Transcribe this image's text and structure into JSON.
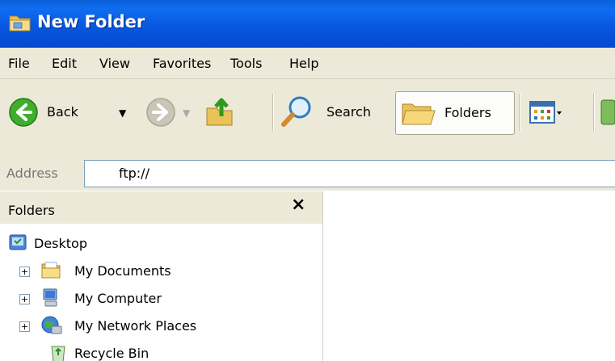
{
  "window": {
    "title": "New Folder"
  },
  "menu": [
    "File",
    "Edit",
    "View",
    "Favorites",
    "Tools",
    "Help"
  ],
  "toolbar": {
    "back_label": "Back",
    "search_label": "Search",
    "folders_label": "Folders"
  },
  "address": {
    "label": "Address",
    "value": "ftp://"
  },
  "folders_pane": {
    "title": "Folders",
    "close_glyph": "×",
    "items": [
      {
        "label": "Desktop",
        "icon": "desktop-icon",
        "expander": false
      },
      {
        "label": "My Documents",
        "icon": "documents-folder-icon",
        "expander": true
      },
      {
        "label": "My Computer",
        "icon": "computer-icon",
        "expander": true
      },
      {
        "label": "My Network Places",
        "icon": "network-places-icon",
        "expander": true
      },
      {
        "label": "Recycle Bin",
        "icon": "recycle-bin-icon",
        "expander": false
      }
    ]
  },
  "colors": {
    "titlebar": "#0858e0",
    "chrome": "#ece9d8",
    "address_border": "#7f9db9"
  }
}
